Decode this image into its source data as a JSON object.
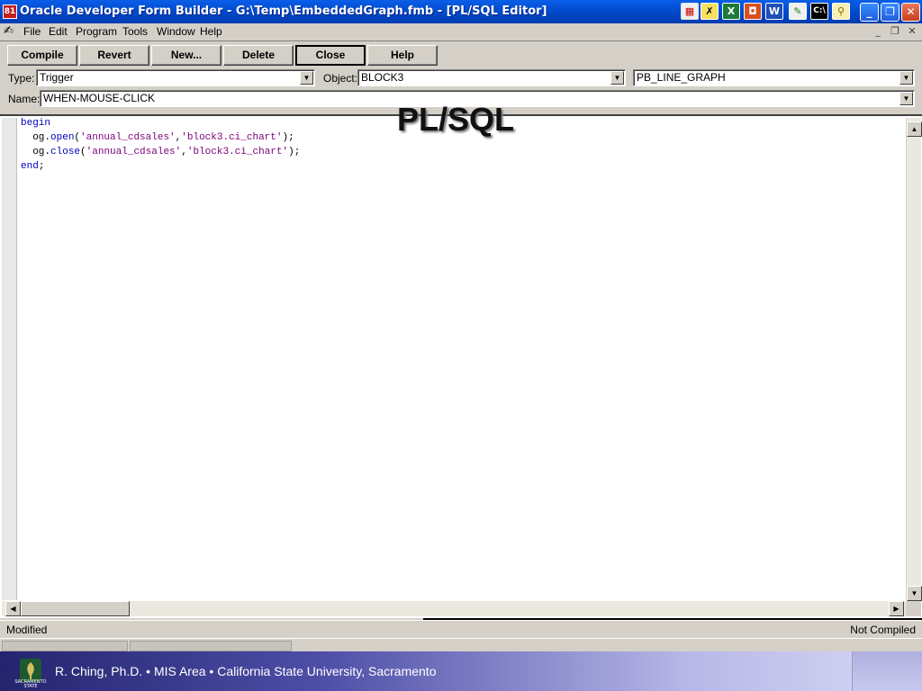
{
  "window": {
    "title": "Oracle Developer Form Builder - G:\\Temp\\EmbeddedGraph.fmb - [PL/SQL Editor]",
    "app_icon_text": "81"
  },
  "menu": [
    "File",
    "Edit",
    "Program",
    "Tools",
    "Window",
    "Help"
  ],
  "toolbar": {
    "compile": "Compile",
    "revert": "Revert",
    "new": "New...",
    "delete": "Delete",
    "close": "Close",
    "help": "Help"
  },
  "fields": {
    "type_label": "Type:",
    "type_value": "Trigger",
    "object_label": "Object:",
    "object_value": "BLOCK3",
    "item_value": "PB_LINE_GRAPH",
    "name_label": "Name:",
    "name_value": "WHEN-MOUSE-CLICK"
  },
  "editor": {
    "watermark": "PL/SQL",
    "lines": [
      {
        "indent": "",
        "parts": [
          {
            "t": "begin",
            "c": "kw"
          }
        ]
      },
      {
        "indent": "  ",
        "parts": [
          {
            "t": "og.",
            "c": "punc"
          },
          {
            "t": "open",
            "c": "kw"
          },
          {
            "t": "(",
            "c": "punc"
          },
          {
            "t": "'annual_cdsales'",
            "c": "str"
          },
          {
            "t": ",",
            "c": "punc"
          },
          {
            "t": "'block3.ci_chart'",
            "c": "str"
          },
          {
            "t": ");",
            "c": "punc"
          }
        ]
      },
      {
        "indent": "  ",
        "parts": [
          {
            "t": "og.",
            "c": "punc"
          },
          {
            "t": "close",
            "c": "kw"
          },
          {
            "t": "(",
            "c": "punc"
          },
          {
            "t": "'annual_cdsales'",
            "c": "str"
          },
          {
            "t": ",",
            "c": "punc"
          },
          {
            "t": "'block3.ci_chart'",
            "c": "str"
          },
          {
            "t": ");",
            "c": "punc"
          }
        ]
      },
      {
        "indent": "",
        "parts": [
          {
            "t": "end",
            "c": "kw"
          },
          {
            "t": ";",
            "c": "punc"
          }
        ]
      }
    ]
  },
  "status": {
    "left": "Modified",
    "right": "Not Compiled"
  },
  "footer": {
    "credit": "R. Ching, Ph.D. • MIS Area  • California State University, Sacramento",
    "seal_text": "SACRAMENTO STATE"
  }
}
